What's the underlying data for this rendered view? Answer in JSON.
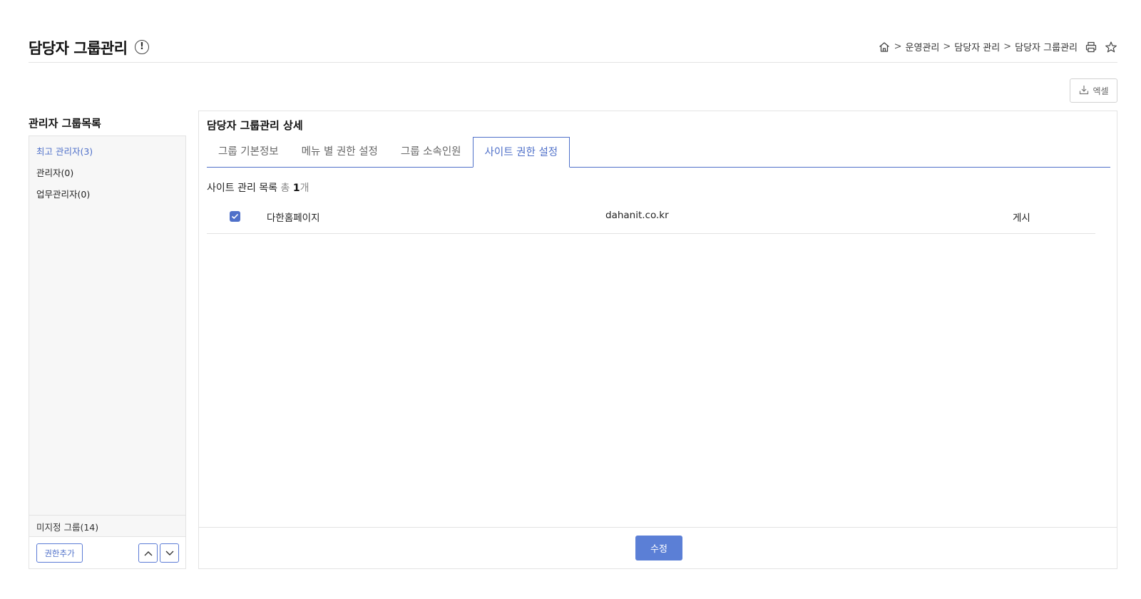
{
  "header": {
    "title": "담당자 그룹관리",
    "info_icon": "exclamation-circle-icon",
    "info_glyph": "!",
    "breadcrumb": {
      "home_icon": "home-icon",
      "separator": ">",
      "items": [
        "운영관리",
        "담당자 관리",
        "담당자 그룹관리"
      ]
    },
    "print_icon": "printer-icon",
    "favorite_icon": "star-icon"
  },
  "toolbar": {
    "excel_label": "엑셀",
    "excel_icon": "download-icon"
  },
  "left_panel": {
    "title": "관리자 그룹목록",
    "groups": [
      {
        "label": "최고 관리자(3)",
        "active": true
      },
      {
        "label": "관리자(0)",
        "active": false
      },
      {
        "label": "업무관리자(0)",
        "active": false
      }
    ],
    "unassigned_label": "미지정 그룹(14)",
    "add_button_label": "권한추가",
    "up_icon": "chevron-up-icon",
    "down_icon": "chevron-down-icon"
  },
  "detail": {
    "title": "담당자 그룹관리 상세",
    "tabs": [
      {
        "label": "그룹 기본정보",
        "active": false
      },
      {
        "label": "메뉴 별 권한 설정",
        "active": false
      },
      {
        "label": "그룹 소속인원",
        "active": false
      },
      {
        "label": "사이트 권한 설정",
        "active": true
      }
    ],
    "summary_prefix": "사이트 관리 목록",
    "summary_total": "총",
    "summary_count": "1",
    "summary_unit": "개",
    "rows": [
      {
        "checked": true,
        "name": "다한홈페이지",
        "domain": "dahanit.co.kr",
        "status": "게시"
      }
    ],
    "save_label": "수정"
  },
  "colors": {
    "accent": "#4f70c9",
    "button_primary": "#5b7fd6",
    "border": "#e3e3e3",
    "panel_bg": "#f7f7f7"
  }
}
